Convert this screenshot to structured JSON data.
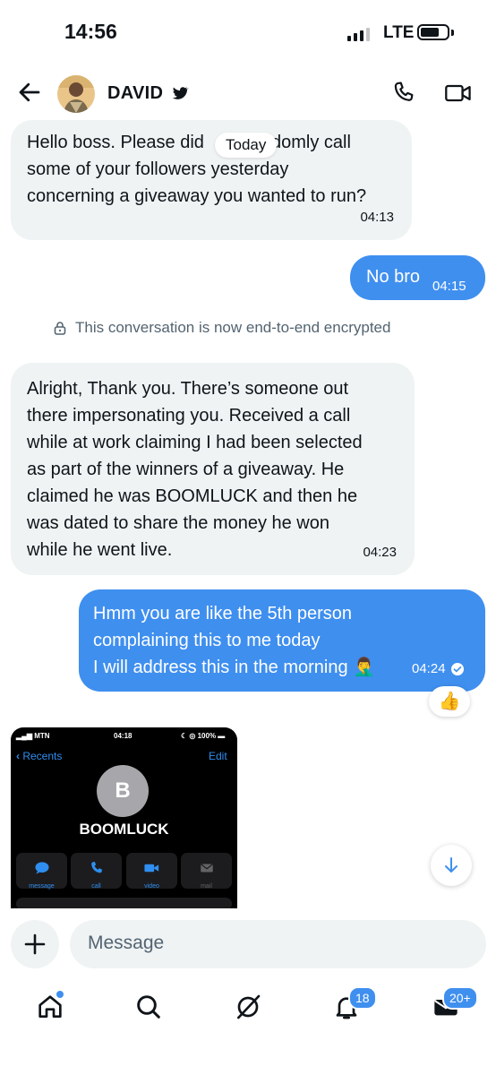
{
  "status_bar": {
    "time": "14:56",
    "network": "LTE"
  },
  "header": {
    "contact_name": "DAVID",
    "verified_icon": "bird-icon",
    "call_icon": "phone-icon",
    "video_icon": "video-camera-icon"
  },
  "date_chip": "Today",
  "messages": [
    {
      "from": "contact",
      "lines": [
        "Hello boss. Please did",
        "ndomly call",
        "some of your followers yesterday",
        "concerning a giveaway you wanted to run?"
      ],
      "time": "04:13"
    },
    {
      "from": "me",
      "text": "No bro",
      "time": "04:15"
    },
    {
      "from": "contact",
      "lines": [
        "Alright, Thank you. There’s someone out",
        "there impersonating you. Received a call",
        "while at work claiming I had been selected",
        "as part of the winners of a giveaway. He",
        "claimed he was BOOMLUCK and then he",
        "was dated to share the money he won",
        "while he went live."
      ],
      "time": "04:23"
    },
    {
      "from": "me",
      "lines": [
        "Hmm you are like the 5th person",
        "complaining this to me today",
        "I will address this in the morning 🤦‍♂️"
      ],
      "time": "04:24",
      "reaction": "👍"
    }
  ],
  "encryption_notice": "This conversation is now end-to-end encrypted",
  "attachment": {
    "carrier": "MTN",
    "time": "04:18",
    "battery": "100%",
    "back_label": "Recents",
    "edit_label": "Edit",
    "initial": "B",
    "contact": "BOOMLUCK",
    "actions": [
      "message",
      "call",
      "video",
      "mail"
    ]
  },
  "composer": {
    "placeholder": "Message"
  },
  "tabs": {
    "notifications_badge": "18",
    "messages_badge": "20+"
  },
  "colors": {
    "accent": "#3f8fef",
    "incoming_bubble": "#eff3f4"
  }
}
